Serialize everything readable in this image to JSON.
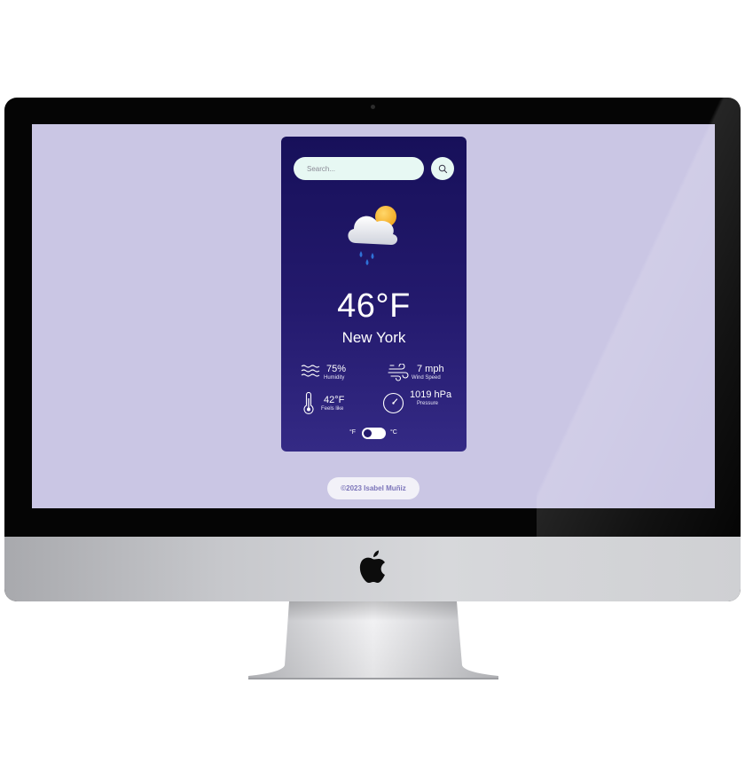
{
  "search": {
    "placeholder": "Search..."
  },
  "weather": {
    "temperature": "46°F",
    "city": "New York",
    "condition_icon": "rain-cloud-sun-icon",
    "humidity": {
      "value": "75%",
      "label": "Humidity"
    },
    "wind": {
      "value": "7 mph",
      "label": "Wind Speed"
    },
    "feels_like": {
      "value": "42°F",
      "label": "Feels like"
    },
    "pressure": {
      "value": "1019 hPa",
      "label": "Pressure"
    }
  },
  "units": {
    "fahrenheit": "°F",
    "celsius": "°C",
    "selected": "°F"
  },
  "footer": {
    "credit": "©2023 Isabel Muñiz"
  },
  "colors": {
    "screen_bg": "#cac6e4",
    "card_top": "#17105a",
    "card_bottom": "#342a85",
    "input_bg": "#e7f8f3",
    "footer_text": "#7b74b9"
  }
}
